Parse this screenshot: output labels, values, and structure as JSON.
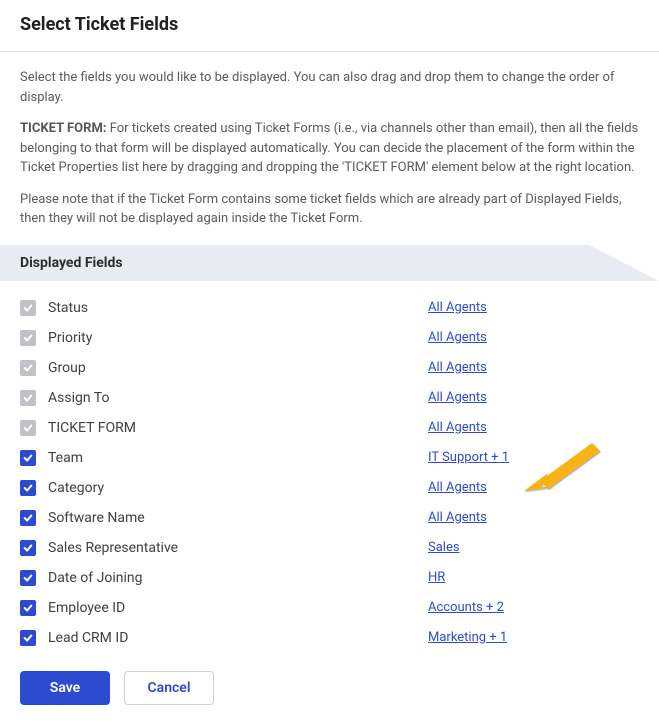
{
  "header": {
    "title": "Select Ticket Fields"
  },
  "intro": {
    "p1": "Select the fields you would like to be displayed. You can also drag and drop them to change the order of display.",
    "tf_label": "TICKET FORM:",
    "p2": " For tickets created using Ticket Forms (i.e., via channels other than email), then all the fields belonging to that form will be displayed automatically. You can decide the placement of the form within the Ticket Properties list here by dragging and dropping the 'TICKET FORM' element below at the right location.",
    "p3": "Please note that if the Ticket Form contains some ticket fields which are already part of Displayed Fields, then they will not be displayed again inside the Ticket Form."
  },
  "section": {
    "title": "Displayed Fields"
  },
  "fields": [
    {
      "name": "status",
      "label": "Status",
      "link": "All Agents",
      "editable": false
    },
    {
      "name": "priority",
      "label": "Priority",
      "link": "All Agents",
      "editable": false
    },
    {
      "name": "group",
      "label": "Group",
      "link": "All Agents",
      "editable": false
    },
    {
      "name": "assign-to",
      "label": "Assign To",
      "link": "All Agents",
      "editable": false
    },
    {
      "name": "ticket-form",
      "label": "TICKET FORM",
      "link": "All Agents",
      "editable": false
    },
    {
      "name": "team",
      "label": "Team",
      "link": "IT Support + 1",
      "editable": true
    },
    {
      "name": "category",
      "label": "Category",
      "link": "All Agents",
      "editable": true
    },
    {
      "name": "software-name",
      "label": "Software Name",
      "link": "All Agents",
      "editable": true
    },
    {
      "name": "sales-rep",
      "label": "Sales Representative",
      "link": "Sales",
      "editable": true
    },
    {
      "name": "date-joining",
      "label": "Date of Joining",
      "link": "HR",
      "editable": true
    },
    {
      "name": "employee-id",
      "label": "Employee ID",
      "link": "Accounts + 2",
      "editable": true
    },
    {
      "name": "lead-crm-id",
      "label": "Lead CRM ID",
      "link": "Marketing + 1",
      "editable": true
    }
  ],
  "buttons": {
    "save": "Save",
    "cancel": "Cancel"
  },
  "annotation": {
    "arrow_points_to": "software-name",
    "color": "#f8b217"
  }
}
